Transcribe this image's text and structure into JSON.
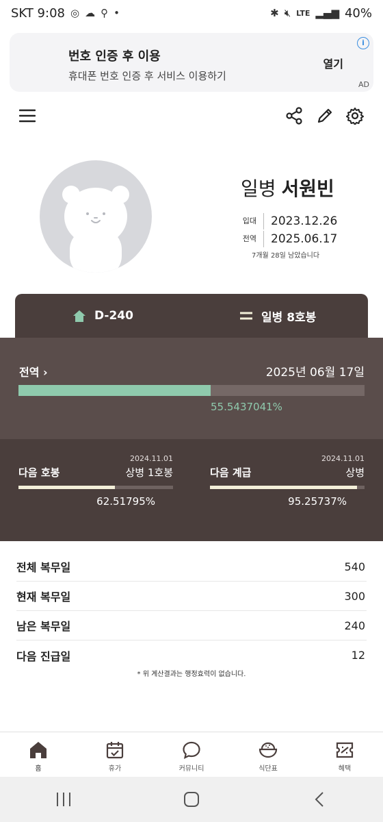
{
  "status_bar": {
    "carrier_time": "SKT 9:08",
    "network": "LTE",
    "battery": "40%"
  },
  "ad": {
    "title": "번호 인증 후 이용",
    "subtitle": "휴대폰 번호 인증 후 서비스 이용하기",
    "open_label": "열기",
    "ad_label": "AD",
    "info_glyph": "i"
  },
  "profile": {
    "rank": "일병",
    "name": "서원빈",
    "enlist_label": "입대",
    "enlist_date": "2023.12.26",
    "discharge_label": "전역",
    "discharge_date": "2025.06.17",
    "remaining": "7개월 28일 남았습니다"
  },
  "tabs": {
    "dday": "D-240",
    "grade": "일병 8호봉"
  },
  "discharge_progress": {
    "label": "전역",
    "date": "2025년 06월 17일",
    "percent_text": "55.5437041%",
    "fraction": 0.555437041
  },
  "next_step": {
    "date": "2024.11.01",
    "label": "다음 호봉",
    "target": "상병 1호봉",
    "percent_text": "62.51795%",
    "fraction": 0.6251795
  },
  "next_rank": {
    "date": "2024.11.01",
    "label": "다음 계급",
    "target": "상병",
    "percent_text": "95.25737%",
    "fraction": 0.9525737
  },
  "stats": [
    {
      "label": "전체 복무일",
      "value": "540"
    },
    {
      "label": "현재 복무일",
      "value": "300"
    },
    {
      "label": "남은 복무일",
      "value": "240"
    },
    {
      "label": "다음 진급일",
      "value": "12"
    }
  ],
  "note": "* 위 계산결과는 행정효력이 없습니다.",
  "bottom_nav": [
    {
      "label": "홈",
      "icon": "home-icon"
    },
    {
      "label": "휴가",
      "icon": "calendar-check-icon"
    },
    {
      "label": "커뮤니티",
      "icon": "chat-bubble-icon"
    },
    {
      "label": "식단표",
      "icon": "rice-bowl-icon"
    },
    {
      "label": "혜택",
      "icon": "ticket-icon"
    }
  ],
  "colors": {
    "panel_dark": "#4a3e3c",
    "panel_mid": "#5a4d4b",
    "accent_green": "#8fcaad",
    "bar_cream": "#f3efd9"
  }
}
